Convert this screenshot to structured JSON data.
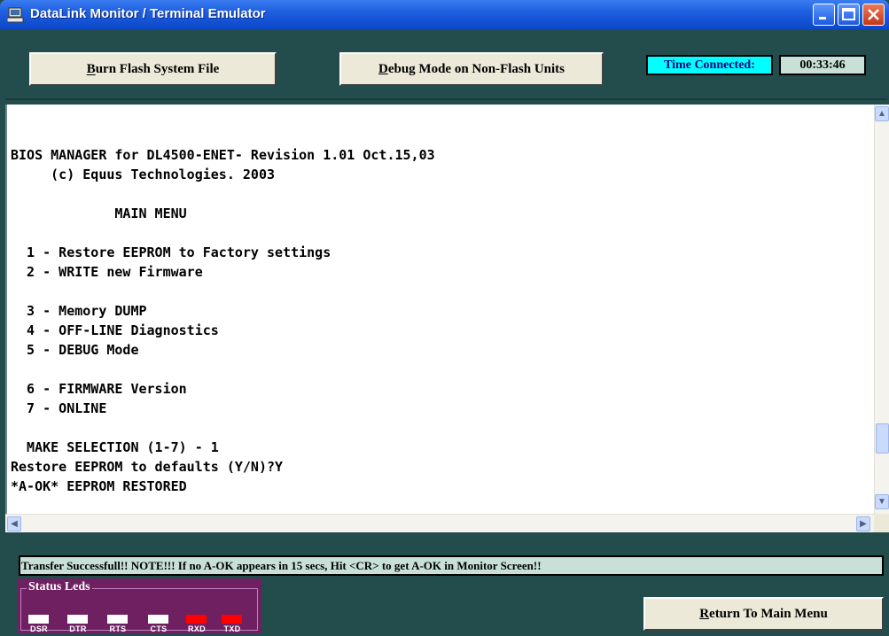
{
  "window": {
    "title": "DataLink Monitor / Terminal Emulator",
    "icon": "computer-terminal-icon"
  },
  "toolbar": {
    "burn_label": "Burn Flash System File",
    "debug_label": "Debug Mode on Non-Flash Units",
    "time_label": "Time Connected:",
    "time_value": "00:33:46"
  },
  "terminal": {
    "lines": [
      "BIOS MANAGER for DL4500-ENET- Revision 1.01 Oct.15,03",
      "     (c) Equus Technologies. 2003",
      "             MAIN MENU",
      "  1 - Restore EEPROM to Factory settings",
      "  2 - WRITE new Firmware",
      "  3 - Memory DUMP",
      "  4 - OFF-LINE Diagnostics",
      "  5 - DEBUG Mode",
      "  6 - FIRMWARE Version",
      "  7 - ONLINE",
      "  MAKE SELECTION (1-7) - 1",
      "Restore EEPROM to defaults (Y/N)?Y",
      "*A-OK* EEPROM RESTORED"
    ]
  },
  "status": {
    "message": "Transfer Successfull!!  NOTE!!! If no A-OK appears in 15 secs, Hit <CR> to get A-OK in Monitor Screen!!",
    "leds_title": "Status Leds",
    "leds": [
      {
        "label": "DSR",
        "state": "off"
      },
      {
        "label": "DTR",
        "state": "off"
      },
      {
        "label": "RTS",
        "state": "off"
      },
      {
        "label": "CTS",
        "state": "off"
      },
      {
        "label": "RXD",
        "state": "on"
      },
      {
        "label": "TXD",
        "state": "on"
      }
    ],
    "led_on_color": "#ff0000",
    "led_off_color": "#ffffff"
  },
  "footer": {
    "return_label": "Return To Main Menu"
  },
  "colors": {
    "background": "#234c4c",
    "accent_cyan": "#00ffff",
    "status_bg": "#c8e0d8",
    "led_panel": "#6f2060"
  }
}
